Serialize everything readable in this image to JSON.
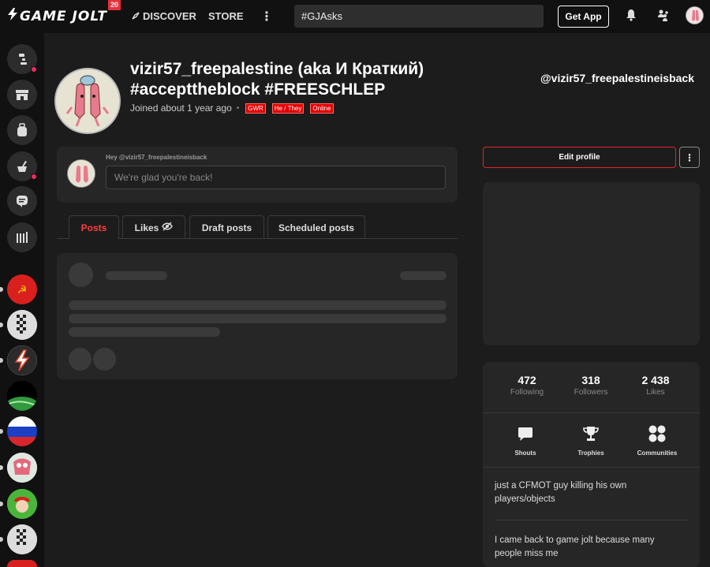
{
  "topbar": {
    "logo_text": "GAME JOLT",
    "logo_badge": "20",
    "discover_label": "DISCOVER",
    "store_label": "STORE",
    "more_label": "⋮",
    "search_value": "#GJAsks",
    "get_app_label": "Get App"
  },
  "sidebar": {
    "buttons": [
      "realms-icon",
      "store-icon",
      "backpack-icon",
      "quests-icon",
      "chat-icon",
      "library-icon"
    ],
    "games": [
      "ussr-flag",
      "checker-avatar",
      "lightning-avatar",
      "dark-hill-avatar",
      "russia-flag",
      "pink-creature-avatar",
      "red-cap-avatar",
      "checker-avatar-2"
    ]
  },
  "profile": {
    "name": "vizir57_freepalestine (aka И Краткий) #accepttheblock #FREESCHLEP",
    "joined": "Joined about 1 year ago",
    "tags": [
      "GWR",
      "He / They",
      "Online"
    ],
    "handle": "@vizir57_freepalestineisback"
  },
  "greeting": {
    "label": "Hey @vizir57_freepalestineisback",
    "placeholder": "We're glad you're back!"
  },
  "tabs": [
    {
      "label": "Posts",
      "active": true
    },
    {
      "label": "Likes"
    },
    {
      "label": "Draft posts"
    },
    {
      "label": "Scheduled posts"
    }
  ],
  "sidepanel": {
    "edit_profile_label": "Edit profile",
    "more_label": "⋮",
    "stats": [
      {
        "value": "472",
        "label": "Following"
      },
      {
        "value": "318",
        "label": "Followers"
      },
      {
        "value": "2 438",
        "label": "Likes"
      }
    ],
    "quick_links": [
      {
        "label": "Shouts",
        "icon": "shouts-icon"
      },
      {
        "label": "Trophies",
        "icon": "trophy-icon"
      },
      {
        "label": "Communities",
        "icon": "communities-icon"
      }
    ],
    "bio": [
      "just a CFMOT guy killing his own players/objects",
      "I came back to game jolt because many people miss me"
    ]
  },
  "colors": {
    "accent": "#e3232b",
    "tag_bg": "#e30000",
    "notify_dot": "#f02a5a"
  }
}
